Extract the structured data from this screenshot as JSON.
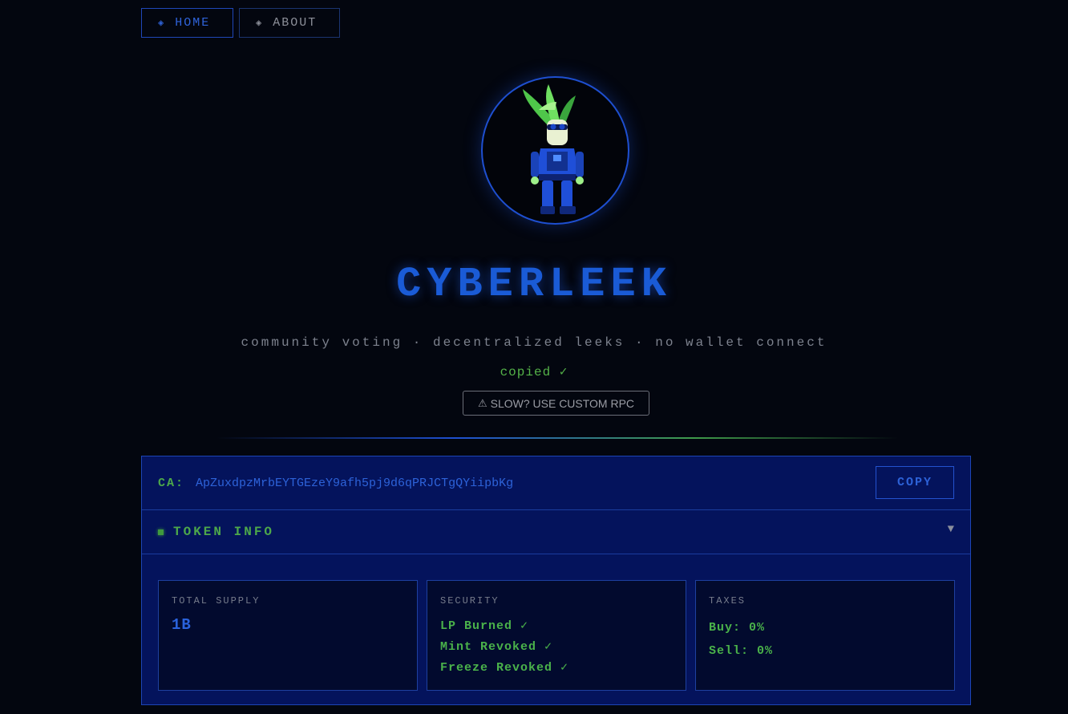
{
  "nav": {
    "home_label": "HOME",
    "about_label": "ABOUT"
  },
  "hero": {
    "title": "CYBERLEEK",
    "tagline": "community voting · decentralized leeks · no wallet connect",
    "copied_status": "copied ✓",
    "rpc_button": "SLOW? USE CUSTOM RPC"
  },
  "contract": {
    "label": "CA:",
    "address": "ApZuxdpzMrbEYTGEzeY9afh5pj9d6qPRJCTgQYiipbKg",
    "copy_label": "COPY"
  },
  "token_info": {
    "header": "TOKEN INFO",
    "supply": {
      "label": "TOTAL SUPPLY",
      "value": "1B"
    },
    "security": {
      "label": "SECURITY",
      "items": [
        "LP Burned ✓",
        "Mint Revoked ✓",
        "Freeze Revoked ✓"
      ]
    },
    "taxes": {
      "label": "TAXES",
      "buy": "Buy: 0%",
      "sell": "Sell: 0%"
    }
  },
  "colors": {
    "background": "#03060f",
    "accent_blue": "#1a5bd6",
    "accent_green": "#4da84a",
    "panel": "#04135c"
  }
}
